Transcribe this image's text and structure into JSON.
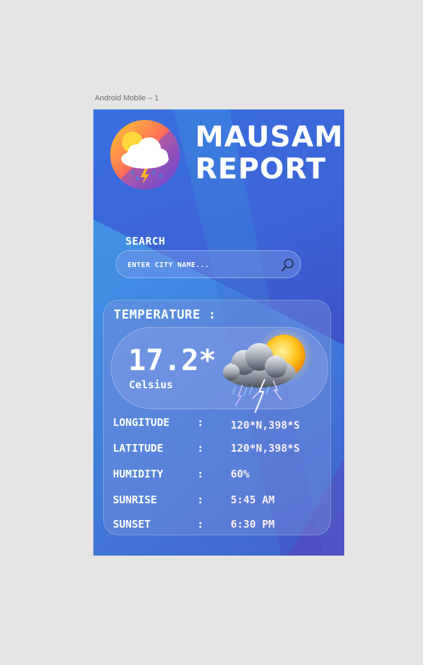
{
  "frame_label": "Android Mobile – 1",
  "app": {
    "title_line1": "MAUSAM",
    "title_line2": "REPORT"
  },
  "search": {
    "label": "SEARCH",
    "placeholder": "ENTER CITY NAME..."
  },
  "temperature": {
    "heading": "TEMPERATURE :",
    "value": "17.2*",
    "unit": "Celsius"
  },
  "details": [
    {
      "label": "LONGITUDE",
      "sep": ":",
      "value": "120*N,398*S"
    },
    {
      "label": "LATITUDE",
      "sep": ":",
      "value": "120*N,398*S"
    },
    {
      "label": "HUMIDITY",
      "sep": ":",
      "value": "60%"
    },
    {
      "label": "SUNRISE",
      "sep": ":",
      "value": "5:45 AM"
    },
    {
      "label": "SUNSET",
      "sep": ":",
      "value": "6:30 PM"
    }
  ],
  "icons": {
    "logo": "weather-logo-icon",
    "search": "search-icon",
    "weather": "thunderstorm-sun-icon"
  }
}
